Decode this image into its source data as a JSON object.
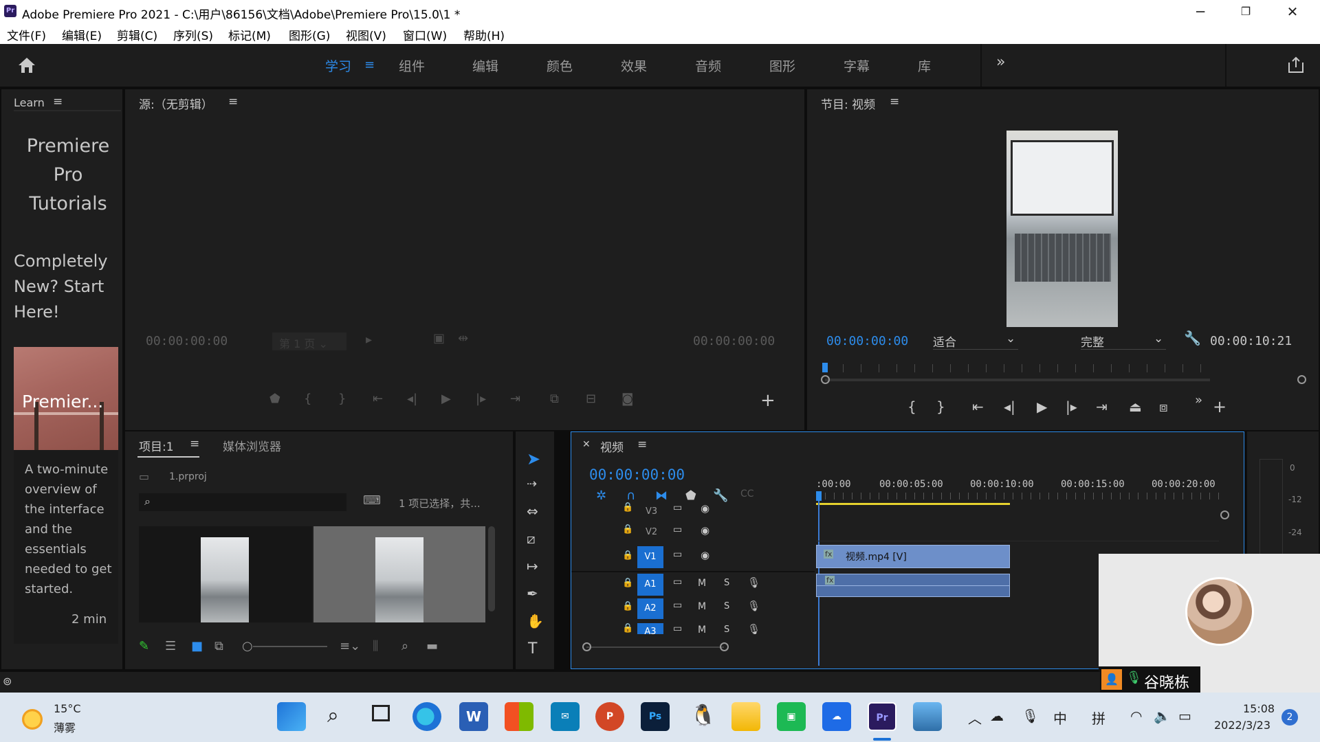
{
  "window": {
    "title": "Adobe Premiere Pro 2021 - C:\\用户\\86156\\文档\\Adobe\\Premiere Pro\\15.0\\1 *",
    "app_icon": "Pr",
    "controls": [
      "minimize-icon",
      "restore-icon",
      "close-icon"
    ]
  },
  "menu": [
    "文件(F)",
    "编辑(E)",
    "剪辑(C)",
    "序列(S)",
    "标记(M)",
    "图形(G)",
    "视图(V)",
    "窗口(W)",
    "帮助(H)"
  ],
  "workspaces": {
    "active": "学习",
    "items": [
      "学习",
      "组件",
      "编辑",
      "颜色",
      "效果",
      "音频",
      "图形",
      "字幕",
      "库"
    ],
    "more": "»"
  },
  "learn": {
    "title": "Learn",
    "heading": "Premiere Pro Tutorials",
    "section": "Completely New? Start Here!",
    "thumb_label": "Premier...",
    "description": "A two-minute overview of the interface and the essentials needed to get started.",
    "duration": "2 min"
  },
  "source": {
    "title": "源:（无剪辑）",
    "tc_in": "00:00:00:00",
    "page": "第 1 页",
    "tc_out": "00:00:00:00"
  },
  "program": {
    "title": "节目: 视频",
    "tc_current": "00:00:00:00",
    "fit": "适合",
    "quality": "完整",
    "tc_duration": "00:00:10:21"
  },
  "project": {
    "tab_project": "项目:1",
    "tab_media": "媒体浏览器",
    "file": "1.prproj",
    "search_placeholder": "",
    "selection": "1 项已选择，共..."
  },
  "timeline": {
    "title": "视频",
    "timecode": "00:00:00:00",
    "ruler": [
      ":00:00",
      "00:00:05:00",
      "00:00:10:00",
      "00:00:15:00",
      "00:00:20:00"
    ],
    "video_tracks": [
      "V3",
      "V2",
      "V1"
    ],
    "audio_tracks": [
      "A1",
      "A2",
      "A3"
    ],
    "track_m": "M",
    "track_s": "S",
    "clip_video": "视频.mp4 [V]",
    "clip_audio": "fx"
  },
  "meter": {
    "labels": [
      "0",
      "-12",
      "-24"
    ]
  },
  "webcam": {
    "name": "谷晓栋"
  },
  "taskbar": {
    "weather_temp": "15°C",
    "weather_desc": "薄雾",
    "ime1": "中",
    "ime2": "拼",
    "time": "15:08",
    "date": "2022/3/23",
    "notif": "2"
  },
  "colors": {
    "accent": "#2d8ceb",
    "panel": "#1e1e1e",
    "clip_video": "#6d8fc9",
    "track_selected": "#1a6fd1",
    "playhead": "#3a7bd5"
  }
}
